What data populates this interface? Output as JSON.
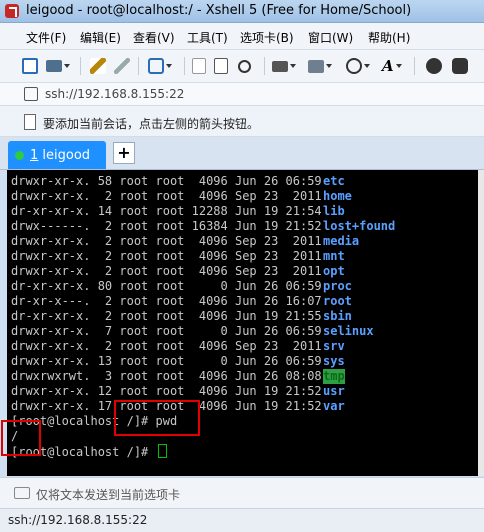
{
  "window": {
    "title": "leigood - root@localhost:/ - Xshell 5 (Free for Home/School)"
  },
  "menu": [
    "文件(F)",
    "编辑(E)",
    "查看(V)",
    "工具(T)",
    "选项卡(B)",
    "窗口(W)",
    "帮助(H)"
  ],
  "toolbar": {
    "icons": [
      "new-session-icon",
      "open-folder-icon",
      "pen-icon",
      "disconnect-icon",
      "settings-icon",
      "copy-icon",
      "paste-icon",
      "find-icon",
      "print-icon",
      "transfer-icon",
      "globe-icon",
      "font-icon",
      "xftp-icon",
      "script-icon"
    ]
  },
  "address": {
    "value": "ssh://192.168.8.155:22"
  },
  "hint": {
    "text": "要添加当前会话，点击左侧的箭头按钮。"
  },
  "tabs": [
    {
      "number": "1",
      "label": "leigood"
    }
  ],
  "add_tab_label": "+",
  "terminal": {
    "listing": [
      {
        "perm": "drwxr-xr-x.",
        "links": "58",
        "owner": "root",
        "group": "root",
        "size": "4096",
        "month": "Jun",
        "day": "26",
        "time": "06:59",
        "name": "etc"
      },
      {
        "perm": "drwxr-xr-x.",
        "links": "2",
        "owner": "root",
        "group": "root",
        "size": "4096",
        "month": "Sep",
        "day": "23",
        "time": "2011",
        "name": "home"
      },
      {
        "perm": "dr-xr-xr-x.",
        "links": "14",
        "owner": "root",
        "group": "root",
        "size": "12288",
        "month": "Jun",
        "day": "19",
        "time": "21:54",
        "name": "lib"
      },
      {
        "perm": "drwx------.",
        "links": "2",
        "owner": "root",
        "group": "root",
        "size": "16384",
        "month": "Jun",
        "day": "19",
        "time": "21:52",
        "name": "lost+found"
      },
      {
        "perm": "drwxr-xr-x.",
        "links": "2",
        "owner": "root",
        "group": "root",
        "size": "4096",
        "month": "Sep",
        "day": "23",
        "time": "2011",
        "name": "media"
      },
      {
        "perm": "drwxr-xr-x.",
        "links": "2",
        "owner": "root",
        "group": "root",
        "size": "4096",
        "month": "Sep",
        "day": "23",
        "time": "2011",
        "name": "mnt"
      },
      {
        "perm": "drwxr-xr-x.",
        "links": "2",
        "owner": "root",
        "group": "root",
        "size": "4096",
        "month": "Sep",
        "day": "23",
        "time": "2011",
        "name": "opt"
      },
      {
        "perm": "dr-xr-xr-x.",
        "links": "80",
        "owner": "root",
        "group": "root",
        "size": "0",
        "month": "Jun",
        "day": "26",
        "time": "06:59",
        "name": "proc"
      },
      {
        "perm": "dr-xr-x---.",
        "links": "2",
        "owner": "root",
        "group": "root",
        "size": "4096",
        "month": "Jun",
        "day": "26",
        "time": "16:07",
        "name": "root"
      },
      {
        "perm": "dr-xr-xr-x.",
        "links": "2",
        "owner": "root",
        "group": "root",
        "size": "4096",
        "month": "Jun",
        "day": "19",
        "time": "21:55",
        "name": "sbin"
      },
      {
        "perm": "drwxr-xr-x.",
        "links": "7",
        "owner": "root",
        "group": "root",
        "size": "0",
        "month": "Jun",
        "day": "26",
        "time": "06:59",
        "name": "selinux"
      },
      {
        "perm": "drwxr-xr-x.",
        "links": "2",
        "owner": "root",
        "group": "root",
        "size": "4096",
        "month": "Sep",
        "day": "23",
        "time": "2011",
        "name": "srv"
      },
      {
        "perm": "drwxr-xr-x.",
        "links": "13",
        "owner": "root",
        "group": "root",
        "size": "0",
        "month": "Jun",
        "day": "26",
        "time": "06:59",
        "name": "sys"
      },
      {
        "perm": "drwxrwxrwt.",
        "links": "3",
        "owner": "root",
        "group": "root",
        "size": "4096",
        "month": "Jun",
        "day": "26",
        "time": "08:08",
        "name": "tmp"
      },
      {
        "perm": "drwxr-xr-x.",
        "links": "12",
        "owner": "root",
        "group": "root",
        "size": "4096",
        "month": "Jun",
        "day": "19",
        "time": "21:52",
        "name": "usr"
      },
      {
        "perm": "drwxr-xr-x.",
        "links": "17",
        "owner": "root",
        "group": "root",
        "size": "4096",
        "month": "Jun",
        "day": "19",
        "time": "21:52",
        "name": "var"
      }
    ],
    "cmd_line": "[root@localhost /]# pwd",
    "output_line": "/",
    "prompt_line": "[root@localhost /]# "
  },
  "send_bar": {
    "placeholder": "仅将文本发送到当前选项卡"
  },
  "status": {
    "text": "ssh://192.168.8.155:22"
  },
  "colors": {
    "dir_name": "#5aa0ff",
    "tmp_highlight": "#2ea043",
    "tab_active": "#1e90ff",
    "annotation": "#e00000",
    "cursor": "#00c000"
  }
}
